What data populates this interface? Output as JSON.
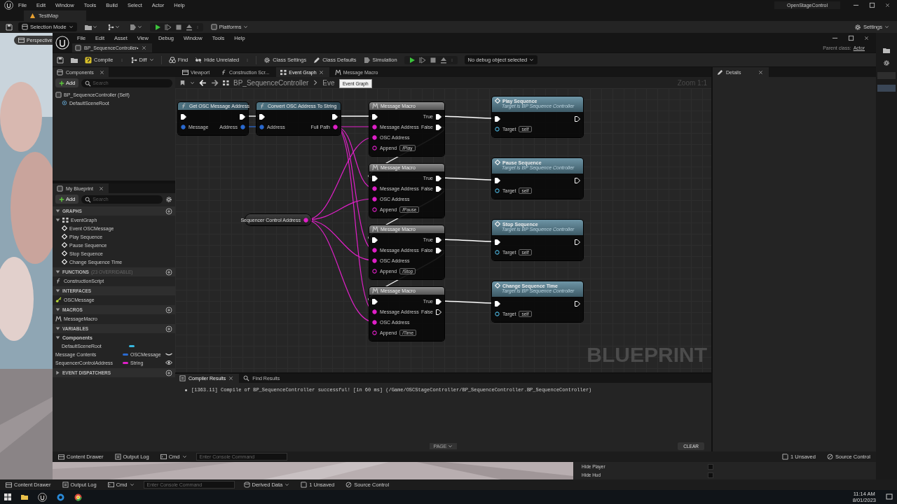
{
  "editor": {
    "menu": [
      "File",
      "Edit",
      "Window",
      "Tools",
      "Build",
      "Select",
      "Actor",
      "Help"
    ],
    "level_tab": "TestMap",
    "mode": "Selection Mode",
    "platforms": "Platforms",
    "settings": "Settings",
    "project": "OpenStageControl"
  },
  "viewport": {
    "view_mode": "Perspective"
  },
  "blueprint": {
    "menu": [
      "File",
      "Edit",
      "Asset",
      "View",
      "Debug",
      "Window",
      "Tools",
      "Help"
    ],
    "asset_tab": "BP_SequenceController•",
    "parent_class_label": "Parent class:",
    "parent_class": "Actor",
    "toolbar": [
      {
        "kind": "compile",
        "label": "Compile"
      },
      {
        "kind": "diff",
        "label": "Diff"
      },
      {
        "kind": "find",
        "label": "Find"
      },
      {
        "kind": "hide",
        "label": "Hide Unrelated"
      },
      {
        "kind": "settings",
        "label": "Class Settings"
      },
      {
        "kind": "defaults",
        "label": "Class Defaults"
      },
      {
        "kind": "simulation",
        "label": "Simulation"
      }
    ],
    "debug_object": "No debug object selected"
  },
  "components": {
    "title": "Components",
    "add": "Add",
    "search_placeholder": "Search",
    "tree": [
      {
        "label": "BP_SequenceController (Self)",
        "children": [
          {
            "label": "DefaultSceneRoot"
          }
        ]
      }
    ]
  },
  "my_blueprint": {
    "title": "My Blueprint",
    "add": "Add",
    "search_placeholder": "Search",
    "sections": [
      {
        "title": "GRAPHS",
        "expanded": true,
        "addable": true,
        "items": [
          {
            "kind": "graph",
            "label": "EventGraph",
            "expanded": true,
            "children": [
              {
                "kind": "event",
                "label": "Event OSCMessage"
              },
              {
                "kind": "event",
                "label": "Play Sequence"
              },
              {
                "kind": "event",
                "label": "Pause Sequence"
              },
              {
                "kind": "event",
                "label": "Stop Sequence"
              },
              {
                "kind": "event",
                "label": "Change Sequence Time"
              }
            ]
          }
        ]
      },
      {
        "title": "FUNCTIONS",
        "note": "(23 OVERRIDABLE)",
        "expanded": true,
        "addable": true,
        "items": [
          {
            "kind": "function",
            "label": "ConstructionScript"
          }
        ]
      },
      {
        "title": "INTERFACES",
        "expanded": true,
        "addable": false,
        "items": [
          {
            "kind": "interface",
            "label": "OSCMessage"
          }
        ]
      },
      {
        "title": "MACROS",
        "expanded": true,
        "addable": true,
        "items": [
          {
            "kind": "macro",
            "label": "MessageMacro"
          }
        ]
      },
      {
        "title": "VARIABLES",
        "expanded": true,
        "addable": true,
        "items": [
          {
            "kind": "category",
            "label": "Components",
            "expanded": true,
            "children": [
              {
                "kind": "variable",
                "label": "DefaultSceneRoot",
                "color": "#38b8e0"
              }
            ]
          },
          {
            "kind": "variable",
            "label": "Message Contents",
            "type": "OSCMessage",
            "color": "#2a6ad0",
            "editable": false
          },
          {
            "kind": "variable",
            "label": "SequencerControlAddress",
            "type": "String",
            "color": "#e020c8",
            "editable": true
          }
        ]
      },
      {
        "title": "EVENT DISPATCHERS",
        "expanded": false,
        "addable": true
      }
    ]
  },
  "graph_tabs": [
    {
      "kind": "viewport",
      "label": "Viewport",
      "selected": false
    },
    {
      "kind": "function",
      "label": "Construction Scr...",
      "selected": false
    },
    {
      "kind": "graph",
      "label": "Event Graph",
      "selected": true
    },
    {
      "kind": "macro",
      "label": "Message Macro",
      "selected": false
    }
  ],
  "tooltip": "Event Graph",
  "breadcrumb": {
    "root": "BP_SequenceController",
    "current": "Eve"
  },
  "graph": {
    "zoom": "Zoom 1:1",
    "watermark": "BLUEPRINT",
    "pure_nodes": [
      {
        "title": "Get OSC Message Address",
        "inputs": [
          {
            "label": "Message",
            "color": "#2a6ad0"
          }
        ],
        "outputs": [
          {
            "label": "Address",
            "color": "#2a6ad0"
          }
        ]
      },
      {
        "title": "Convert OSC Address To String",
        "inputs": [
          {
            "label": "Address",
            "color": "#2a6ad0"
          }
        ],
        "outputs": [
          {
            "label": "Full Path",
            "color": "#e020c8"
          }
        ]
      }
    ],
    "macros": [
      {
        "title": "Message Macro",
        "true_label": "True",
        "false_label": "False",
        "false_linked": true,
        "inputs": [
          "Message Address",
          "OSC Address"
        ],
        "append_label": "Append",
        "append": "/Play"
      },
      {
        "title": "Message Macro",
        "true_label": "True",
        "false_label": "False",
        "false_linked": true,
        "inputs": [
          "Message Address",
          "OSC Address"
        ],
        "append_label": "Append",
        "append": "/Pause"
      },
      {
        "title": "Message Macro",
        "true_label": "True",
        "false_label": "False",
        "false_linked": true,
        "inputs": [
          "Message Address",
          "OSC Address"
        ],
        "append_label": "Append",
        "append": "/Stop"
      },
      {
        "title": "Message Macro",
        "true_label": "True",
        "false_label": "False",
        "false_linked": false,
        "inputs": [
          "Message Address",
          "OSC Address"
        ],
        "append_label": "Append",
        "append": "/Time"
      }
    ],
    "calls": [
      {
        "title": "Play Sequence",
        "subtitle": "Target is BP Sequence Controller",
        "target_label": "Target",
        "target": "self"
      },
      {
        "title": "Pause Sequence",
        "subtitle": "Target is BP Sequence Controller",
        "target_label": "Target",
        "target": "self"
      },
      {
        "title": "Stop Sequence",
        "subtitle": "Target is BP Sequence Controller",
        "target_label": "Target",
        "target": "self"
      },
      {
        "title": "Change Sequence Time",
        "subtitle": "Target is BP Sequence Controller",
        "target_label": "Target",
        "target": "self"
      }
    ],
    "variable_node": {
      "title": "Sequencer Control Address",
      "color": "#e020c8"
    }
  },
  "compiler": {
    "tabs": [
      {
        "kind": "results",
        "label": "Compiler Results",
        "selected": true
      },
      {
        "kind": "find",
        "label": "Find Results",
        "selected": false
      }
    ],
    "messages": [
      "[1363.11] Compile of BP_SequenceController successful! [in 60 ms] (/Game/OSCStageController/BP_SequenceController.BP_SequenceController)"
    ],
    "page": "PAGE",
    "clear": "CLEAR"
  },
  "details": {
    "title": "Details"
  },
  "bp_status": {
    "content_drawer": "Content Drawer",
    "output_log": "Output Log",
    "cmd": "Cmd",
    "console_placeholder": "Enter Console Command",
    "unsaved": "1 Unsaved",
    "source_control": "Source Control"
  },
  "level_details": {
    "rows": [
      {
        "label": "Hide Player",
        "checked": false
      },
      {
        "label": "Hide Hud",
        "checked": false
      }
    ]
  },
  "editor_status": {
    "content_drawer": "Content Drawer",
    "output_log": "Output Log",
    "cmd": "Cmd",
    "console_placeholder": "Enter Console Command",
    "derived_data": "Derived Data",
    "unsaved": "1 Unsaved",
    "source_control": "Source Control"
  },
  "taskbar": {
    "time": "11:14 AM",
    "date": "8/01/2023"
  }
}
